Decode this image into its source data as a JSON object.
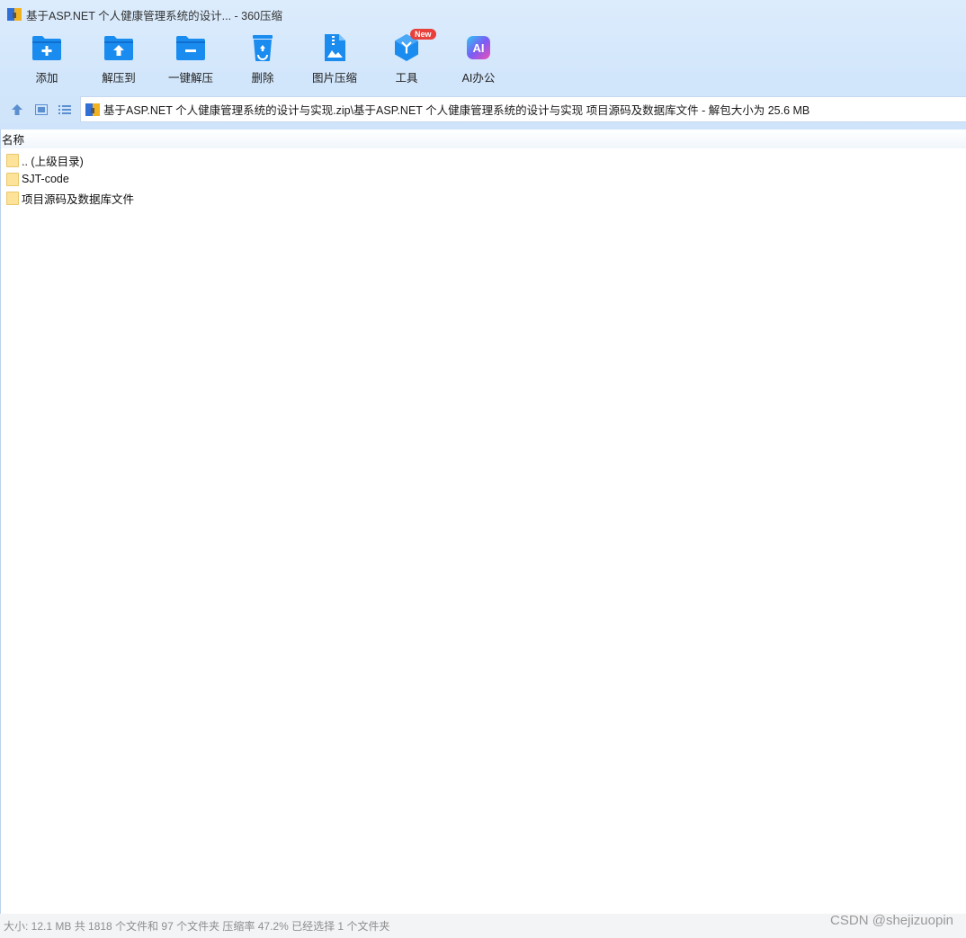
{
  "window": {
    "title": "基于ASP.NET 个人健康管理系统的设计... - 360压缩"
  },
  "toolbar": {
    "buttons": [
      {
        "label": "添加",
        "icon": "folder-add-icon"
      },
      {
        "label": "解压到",
        "icon": "folder-extract-icon"
      },
      {
        "label": "一键解压",
        "icon": "folder-oneclick-extract-icon"
      },
      {
        "label": "删除",
        "icon": "recycle-bin-icon"
      },
      {
        "label": "图片压缩",
        "icon": "image-compress-icon"
      },
      {
        "label": "工具",
        "icon": "tools-icon",
        "badge": "New"
      },
      {
        "label": "AI办公",
        "icon": "ai-office-icon"
      }
    ]
  },
  "navigation": {
    "up_icon": "arrow-up-icon",
    "thumbnail_view_icon": "thumbnail-view-icon",
    "list_view_icon": "list-view-icon"
  },
  "address": {
    "path": "基于ASP.NET 个人健康管理系统的设计与实现.zip\\基于ASP.NET 个人健康管理系统的设计与实现 项目源码及数据库文件 - 解包大小为 25.6 MB"
  },
  "file_list": {
    "column_header": "名称",
    "items": [
      {
        "name": ".. (上级目录)",
        "type": "folder"
      },
      {
        "name": "SJT-code",
        "type": "folder"
      },
      {
        "name": "项目源码及数据库文件",
        "type": "folder"
      }
    ]
  },
  "status": {
    "text": "大小: 12.1 MB 共 1818 个文件和 97 个文件夹 压缩率 47.2% 已经选择 1 个文件夹"
  },
  "watermark": "CSDN @shejizuopin",
  "colors": {
    "toolbar_bg": "#d2e6fb",
    "icon_blue": "#1a8cf0",
    "badge_red": "#e8403a",
    "folder_yellow": "#fde39a"
  }
}
